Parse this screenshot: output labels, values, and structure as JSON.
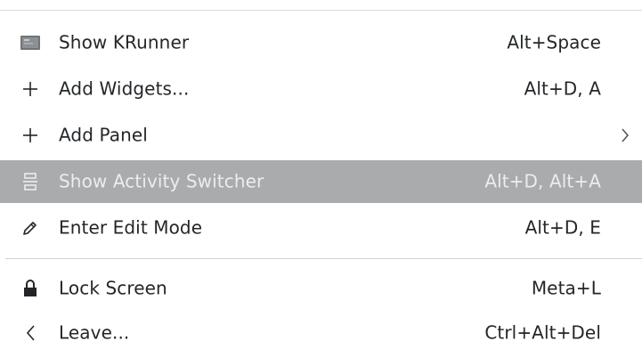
{
  "menu": {
    "items": [
      {
        "label": "Show KRunner",
        "shortcut": "Alt+Space",
        "icon": "krunner-icon"
      },
      {
        "label": "Add Widgets...",
        "shortcut": "Alt+D, A",
        "icon": "plus-icon"
      },
      {
        "label": "Add Panel",
        "shortcut": "",
        "icon": "plus-icon",
        "submenu": true
      },
      {
        "label": "Show Activity Switcher",
        "shortcut": "Alt+D, Alt+A",
        "icon": "activities-icon",
        "highlighted": true
      },
      {
        "label": "Enter Edit Mode",
        "shortcut": "Alt+D, E",
        "icon": "pencil-icon"
      },
      {
        "label": "Lock Screen",
        "shortcut": "Meta+L",
        "icon": "lock-icon"
      },
      {
        "label": "Leave...",
        "shortcut": "Ctrl+Alt+Del",
        "icon": "chevron-left-icon"
      }
    ]
  },
  "colors": {
    "highlight_bg": "#a9abad",
    "text": "#232629",
    "separator": "#cfd0d1"
  }
}
